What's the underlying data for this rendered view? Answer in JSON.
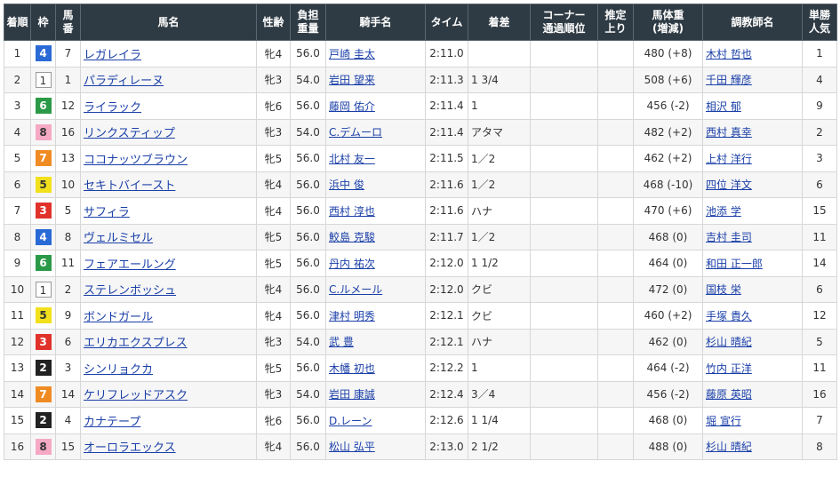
{
  "headers": {
    "rank": "着順",
    "waku": "枠",
    "umaban": "馬\n番",
    "name": "馬名",
    "sexage": "性齢",
    "weight": "負担\n重量",
    "jockey": "騎手名",
    "time": "タイム",
    "margin": "着差",
    "corner": "コーナー\n通過順位",
    "agari": "推定\n上り",
    "bodyweight": "馬体重\n(増減)",
    "trainer": "調教師名",
    "pop": "単勝\n人気"
  },
  "rows": [
    {
      "rank": "1",
      "waku": "4",
      "umaban": "7",
      "name": "レガレイラ",
      "sexage": "牝4",
      "weight": "56.0",
      "jockey": "戸崎 圭太",
      "time": "2:11.0",
      "margin": "",
      "corner": "",
      "agari": "",
      "bodyweight": "480 (+8)",
      "trainer": "木村 哲也",
      "pop": "1"
    },
    {
      "rank": "2",
      "waku": "1",
      "umaban": "1",
      "name": "パラディレーヌ",
      "sexage": "牝3",
      "weight": "54.0",
      "jockey": "岩田 望来",
      "time": "2:11.3",
      "margin": "1 3/4",
      "corner": "",
      "agari": "",
      "bodyweight": "508 (+6)",
      "trainer": "千田 輝彦",
      "pop": "4"
    },
    {
      "rank": "3",
      "waku": "6",
      "umaban": "12",
      "name": "ライラック",
      "sexage": "牝6",
      "weight": "56.0",
      "jockey": "藤岡 佑介",
      "time": "2:11.4",
      "margin": "1",
      "corner": "",
      "agari": "",
      "bodyweight": "456 (-2)",
      "trainer": "相沢 郁",
      "pop": "9"
    },
    {
      "rank": "4",
      "waku": "8",
      "umaban": "16",
      "name": "リンクスティップ",
      "sexage": "牝3",
      "weight": "54.0",
      "jockey": "C.デムーロ",
      "time": "2:11.4",
      "margin": "アタマ",
      "corner": "",
      "agari": "",
      "bodyweight": "482 (+2)",
      "trainer": "西村 真幸",
      "pop": "2"
    },
    {
      "rank": "5",
      "waku": "7",
      "umaban": "13",
      "name": "ココナッツブラウン",
      "sexage": "牝5",
      "weight": "56.0",
      "jockey": "北村 友一",
      "time": "2:11.5",
      "margin": "1／2",
      "corner": "",
      "agari": "",
      "bodyweight": "462 (+2)",
      "trainer": "上村 洋行",
      "pop": "3"
    },
    {
      "rank": "6",
      "waku": "5",
      "umaban": "10",
      "name": "セキトバイースト",
      "sexage": "牝4",
      "weight": "56.0",
      "jockey": "浜中 俊",
      "time": "2:11.6",
      "margin": "1／2",
      "corner": "",
      "agari": "",
      "bodyweight": "468 (-10)",
      "trainer": "四位 洋文",
      "pop": "6"
    },
    {
      "rank": "7",
      "waku": "3",
      "umaban": "5",
      "name": "サフィラ",
      "sexage": "牝4",
      "weight": "56.0",
      "jockey": "西村 淳也",
      "time": "2:11.6",
      "margin": "ハナ",
      "corner": "",
      "agari": "",
      "bodyweight": "470 (+6)",
      "trainer": "池添 学",
      "pop": "15"
    },
    {
      "rank": "8",
      "waku": "4",
      "umaban": "8",
      "name": "ヴェルミセル",
      "sexage": "牝5",
      "weight": "56.0",
      "jockey": "鮫島 克駿",
      "time": "2:11.7",
      "margin": "1／2",
      "corner": "",
      "agari": "",
      "bodyweight": "468 (0)",
      "trainer": "吉村 圭司",
      "pop": "11"
    },
    {
      "rank": "9",
      "waku": "6",
      "umaban": "11",
      "name": "フェアエールング",
      "sexage": "牝5",
      "weight": "56.0",
      "jockey": "丹内 祐次",
      "time": "2:12.0",
      "margin": "1 1/2",
      "corner": "",
      "agari": "",
      "bodyweight": "464 (0)",
      "trainer": "和田 正一郎",
      "pop": "14"
    },
    {
      "rank": "10",
      "waku": "1",
      "umaban": "2",
      "name": "ステレンボッシュ",
      "sexage": "牝4",
      "weight": "56.0",
      "jockey": "C.ルメール",
      "time": "2:12.0",
      "margin": "クビ",
      "corner": "",
      "agari": "",
      "bodyweight": "472 (0)",
      "trainer": "国枝 栄",
      "pop": "6"
    },
    {
      "rank": "11",
      "waku": "5",
      "umaban": "9",
      "name": "ボンドガール",
      "sexage": "牝4",
      "weight": "56.0",
      "jockey": "津村 明秀",
      "time": "2:12.1",
      "margin": "クビ",
      "corner": "",
      "agari": "",
      "bodyweight": "460 (+2)",
      "trainer": "手塚 貴久",
      "pop": "12"
    },
    {
      "rank": "12",
      "waku": "3",
      "umaban": "6",
      "name": "エリカエクスプレス",
      "sexage": "牝3",
      "weight": "54.0",
      "jockey": "武 豊",
      "time": "2:12.1",
      "margin": "ハナ",
      "corner": "",
      "agari": "",
      "bodyweight": "462 (0)",
      "trainer": "杉山 晴紀",
      "pop": "5"
    },
    {
      "rank": "13",
      "waku": "2",
      "umaban": "3",
      "name": "シンリョクカ",
      "sexage": "牝5",
      "weight": "56.0",
      "jockey": "木幡 初也",
      "time": "2:12.2",
      "margin": "1",
      "corner": "",
      "agari": "",
      "bodyweight": "464 (-2)",
      "trainer": "竹内 正洋",
      "pop": "11"
    },
    {
      "rank": "14",
      "waku": "7",
      "umaban": "14",
      "name": "ケリフレッドアスク",
      "sexage": "牝3",
      "weight": "54.0",
      "jockey": "岩田 康誠",
      "time": "2:12.4",
      "margin": "3／4",
      "corner": "",
      "agari": "",
      "bodyweight": "456 (-2)",
      "trainer": "藤原 英昭",
      "pop": "16"
    },
    {
      "rank": "15",
      "waku": "2",
      "umaban": "4",
      "name": "カナテープ",
      "sexage": "牝6",
      "weight": "56.0",
      "jockey": "D.レーン",
      "time": "2:12.6",
      "margin": "1 1/4",
      "corner": "",
      "agari": "",
      "bodyweight": "468 (0)",
      "trainer": "堀 宣行",
      "pop": "7"
    },
    {
      "rank": "16",
      "waku": "8",
      "umaban": "15",
      "name": "オーロラエックス",
      "sexage": "牝4",
      "weight": "56.0",
      "jockey": "松山 弘平",
      "time": "2:13.0",
      "margin": "2 1/2",
      "corner": "",
      "agari": "",
      "bodyweight": "488 (0)",
      "trainer": "杉山 晴紀",
      "pop": "8"
    }
  ]
}
